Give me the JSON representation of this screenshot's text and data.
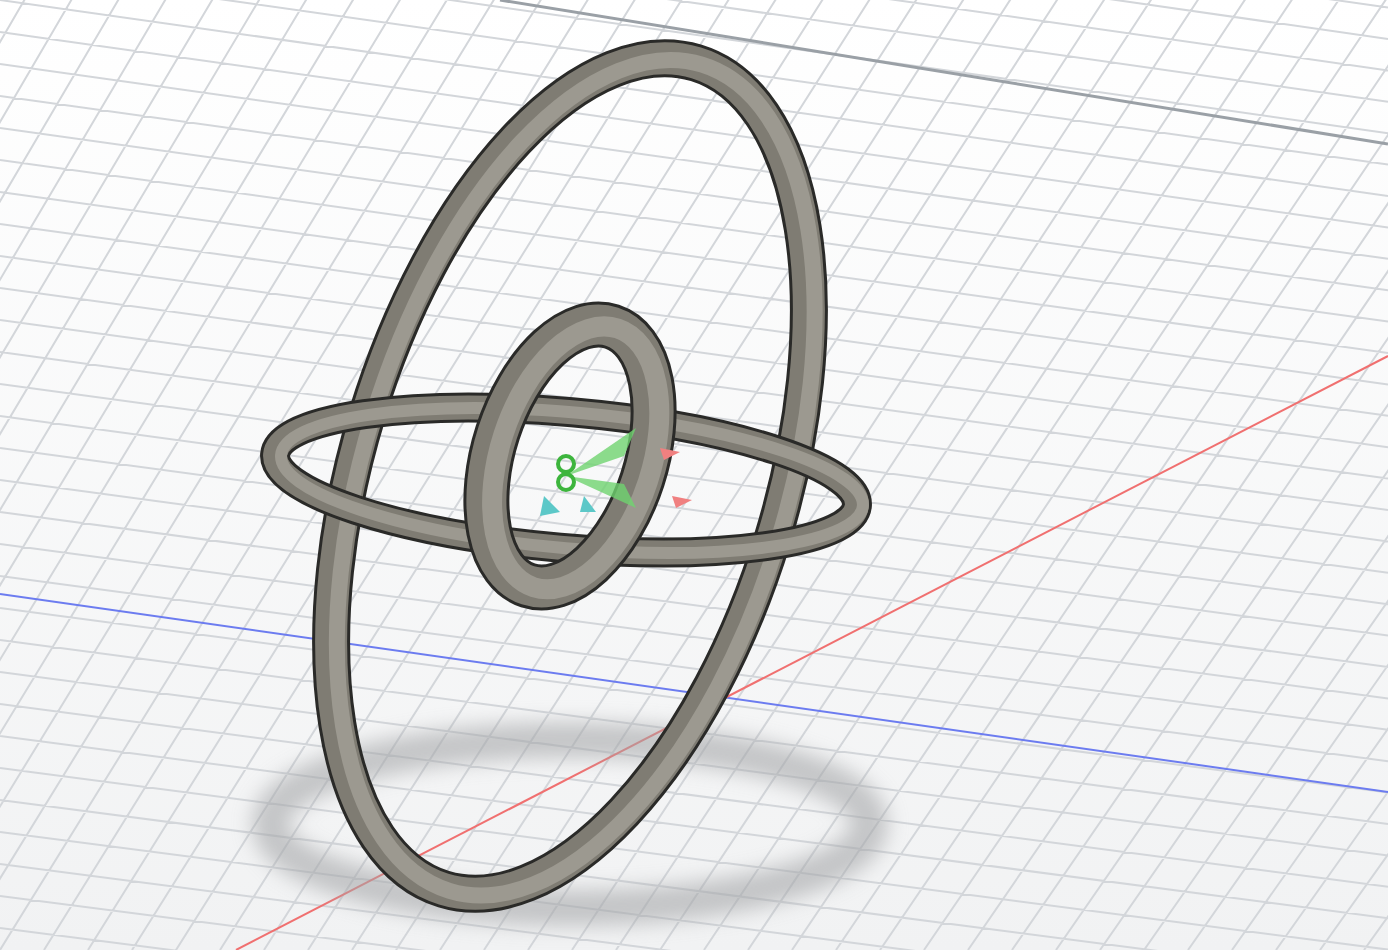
{
  "viewport": {
    "grid": true,
    "axes": true,
    "shadow": true,
    "gizmo": true
  }
}
